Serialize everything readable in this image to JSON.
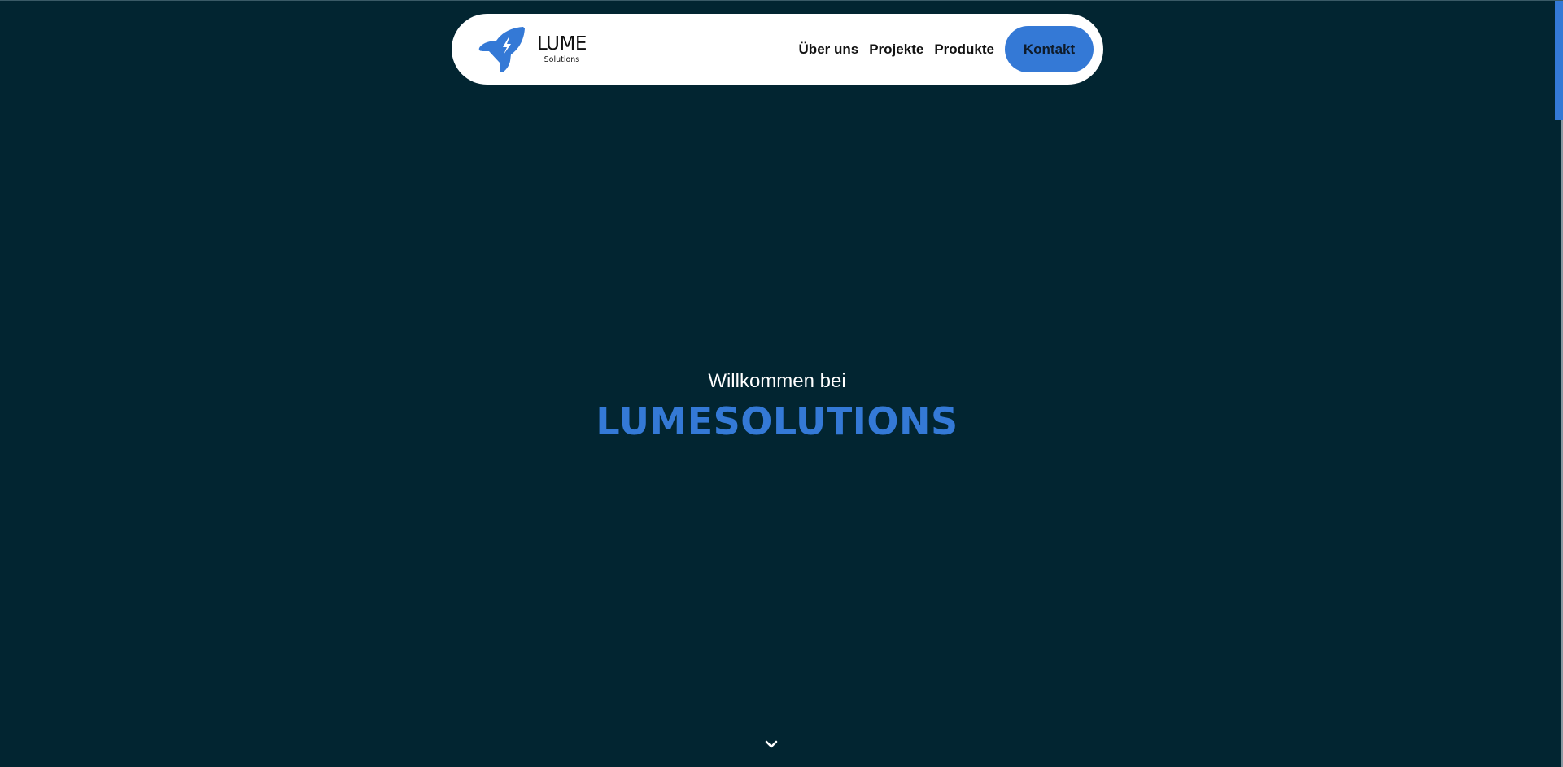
{
  "nav": {
    "brand_name": "LUME",
    "brand_sub": "Solutions",
    "links": [
      {
        "label": "Über uns"
      },
      {
        "label": "Projekte"
      },
      {
        "label": "Produkte"
      }
    ],
    "cta_label": "Kontakt"
  },
  "hero": {
    "greeting": "Willkommen bei",
    "title": "LUMESOLUTIONS"
  },
  "icons": {
    "logo": "rocket-icon",
    "scroll": "chevron-down-icon"
  },
  "colors": {
    "background": "#022531",
    "accent": "#3479d6",
    "nav_background": "#ffffff"
  }
}
